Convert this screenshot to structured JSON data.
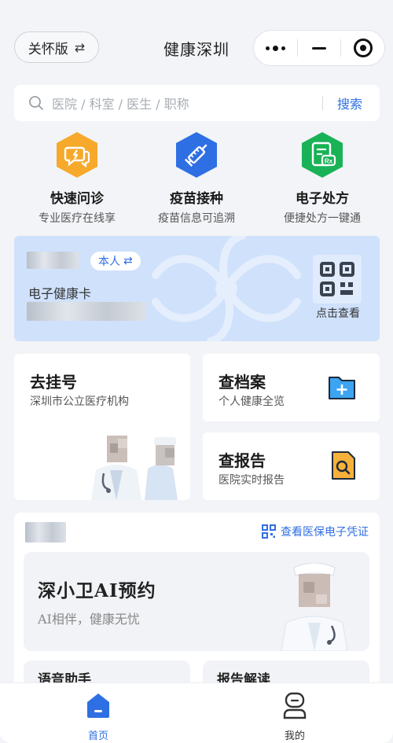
{
  "header": {
    "care_mode_label": "关怀版",
    "care_mode_icon": "swap-icon",
    "title": "健康深圳",
    "capsule_icons": [
      "more-dots-icon",
      "minimize-icon",
      "close-target-icon"
    ]
  },
  "search": {
    "placeholder": "医院 / 科室 / 医生 / 职称",
    "button_label": "搜索"
  },
  "services": [
    {
      "title": "快速问诊",
      "subtitle": "专业医疗在线享",
      "icon": "consult-icon",
      "color": "#f6a92b"
    },
    {
      "title": "疫苗接种",
      "subtitle": "疫苗信息可追溯",
      "icon": "syringe-icon",
      "color": "#2f6fe4"
    },
    {
      "title": "电子处方",
      "subtitle": "便捷处方一键通",
      "icon": "prescription-icon",
      "color": "#19b257"
    }
  ],
  "health_card": {
    "self_tag": "本人",
    "label": "电子健康卡",
    "qr_label": "点击查看"
  },
  "tiles": {
    "register": {
      "title": "去挂号",
      "subtitle": "深圳市公立医疗机构"
    },
    "archive": {
      "title": "查档案",
      "subtitle": "个人健康全览"
    },
    "report": {
      "title": "查报告",
      "subtitle": "医院实时报告"
    }
  },
  "section": {
    "voucher_link": "查看医保电子凭证",
    "ai_card": {
      "title": "深小卫AI预约",
      "subtitle": "AI相伴，健康无忧"
    },
    "mini_cards": [
      {
        "title": "语音助手"
      },
      {
        "title": "报告解读"
      }
    ]
  },
  "tabbar": {
    "items": [
      {
        "label": "首页",
        "active": true
      },
      {
        "label": "我的",
        "active": false
      }
    ]
  },
  "colors": {
    "accent": "#2f6fe4",
    "page_bg": "#f2f4f7",
    "card_blue": "#cfe1fb"
  }
}
